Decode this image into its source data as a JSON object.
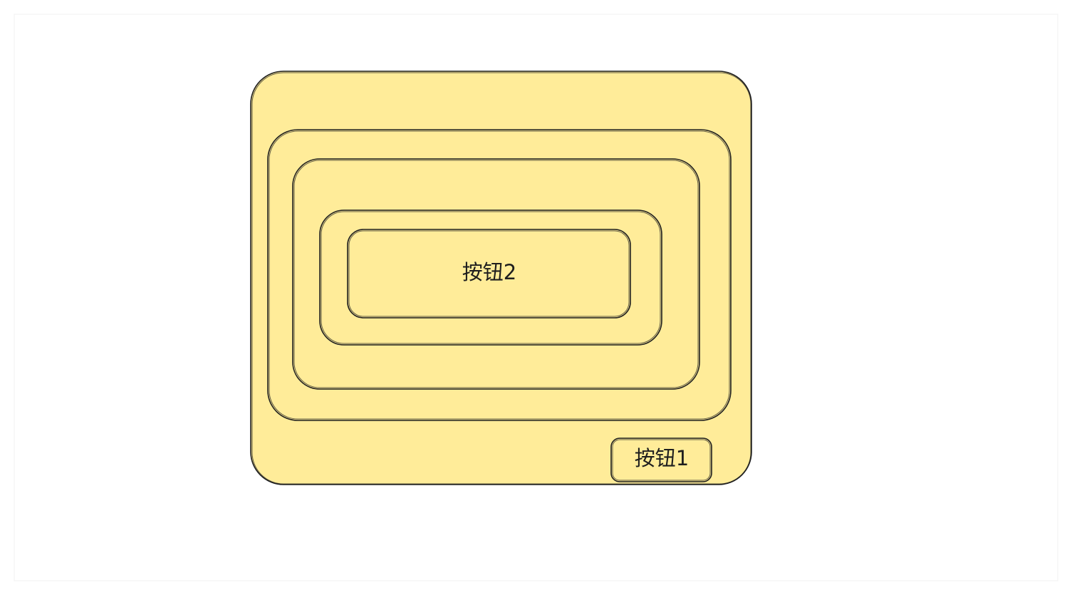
{
  "colors": {
    "fill": "#ffec99",
    "stroke": "#1e1e1e",
    "frame": "#f0f0f0",
    "background": "#ffffff"
  },
  "buttons": {
    "button_1_label": "按钮1",
    "button_2_label": "按钮2"
  }
}
